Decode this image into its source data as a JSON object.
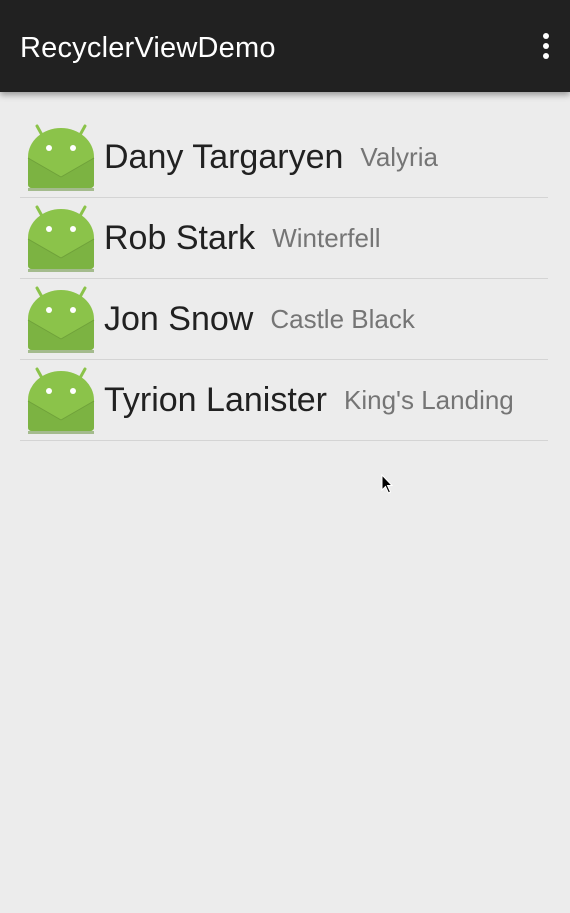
{
  "app_bar": {
    "title": "RecyclerViewDemo",
    "menu_icon": "overflow-menu-icon"
  },
  "list": {
    "item_icon": "android-icon",
    "items": [
      {
        "name": "Dany Targaryen",
        "place": "Valyria"
      },
      {
        "name": "Rob Stark",
        "place": "Winterfell"
      },
      {
        "name": "Jon Snow",
        "place": "Castle Black"
      },
      {
        "name": "Tyrion Lanister",
        "place": "King's Landing"
      }
    ]
  },
  "colors": {
    "app_bar": "#212121",
    "background": "#ececec",
    "android_green": "#8bc34a",
    "name_text": "#212121",
    "place_text": "#757575"
  }
}
